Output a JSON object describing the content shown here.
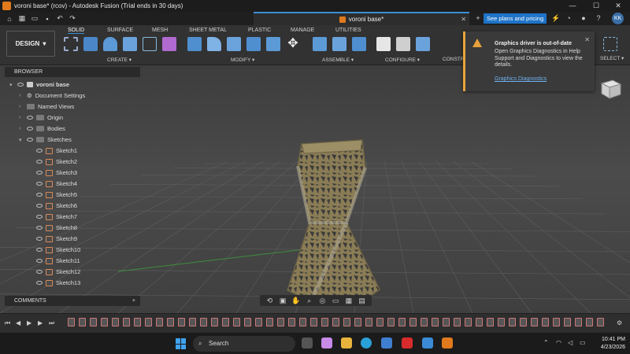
{
  "title_bar": {
    "title": "voroni base* (rcov) - Autodesk Fusion (Trial ends in 30 days)",
    "minimize": "—",
    "maximize": "☐",
    "close": "✕"
  },
  "doc_tab": {
    "label": "voroni base*",
    "close": "✕"
  },
  "app_bar": {
    "plans_button": "See plans and pricing",
    "avatar": "KK"
  },
  "ribbon": {
    "design_button": "DESIGN",
    "tabs": [
      "SOLID",
      "SURFACE",
      "MESH",
      "SHEET METAL",
      "PLASTIC",
      "MANAGE",
      "UTILITIES"
    ],
    "groups": [
      "CREATE",
      "MODIFY",
      "ASSEMBLE",
      "CONFIGURE",
      "CONSTR",
      "SELECT"
    ]
  },
  "notification": {
    "title": "Graphics driver is out-of-date",
    "body": "Open Graphics Diagnostics in Help Support and Diagnostics to view the details.",
    "link": "Graphics Diagnostics"
  },
  "browser": {
    "header": "BROWSER",
    "root": "voroni base",
    "items": [
      "Document Settings",
      "Named Views",
      "Origin",
      "Bodies",
      "Sketches"
    ],
    "sketches": [
      "Sketch1",
      "Sketch2",
      "Sketch3",
      "Sketch4",
      "Sketch5",
      "Sketch6",
      "Sketch7",
      "Sketch8",
      "Sketch9",
      "Sketch10",
      "Sketch11",
      "Sketch12",
      "Sketch13"
    ]
  },
  "comments": {
    "label": "COMMENTS"
  },
  "taskbar": {
    "search": "Search",
    "time": "10:41 PM",
    "date": "4/23/2026"
  },
  "colors": {
    "accent": "#1e74c9",
    "model": "#8a7c55",
    "warning": "#e6a23c"
  }
}
